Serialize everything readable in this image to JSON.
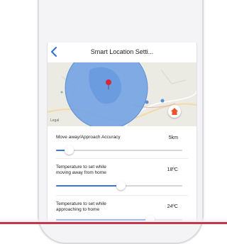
{
  "header": {
    "title": "Smart Location Setti..."
  },
  "map": {
    "legal_label": "Legal"
  },
  "settings": [
    {
      "label_lines": [
        "Move away/Approach Accuracy"
      ],
      "value": "5km",
      "level": 0.1
    },
    {
      "label_lines": [
        "Temperature to set while",
        "moving away from home"
      ],
      "value": "18ºC",
      "level": 0.51
    },
    {
      "label_lines": [
        "Temperature to set while",
        "approaching to home"
      ],
      "value": "24ºC",
      "level": 0.74
    }
  ],
  "colors": {
    "accent": "#3a78d8",
    "radius_fill": "#6c9fe3",
    "home_button": "#e8542c",
    "pin": "#d8273a"
  }
}
